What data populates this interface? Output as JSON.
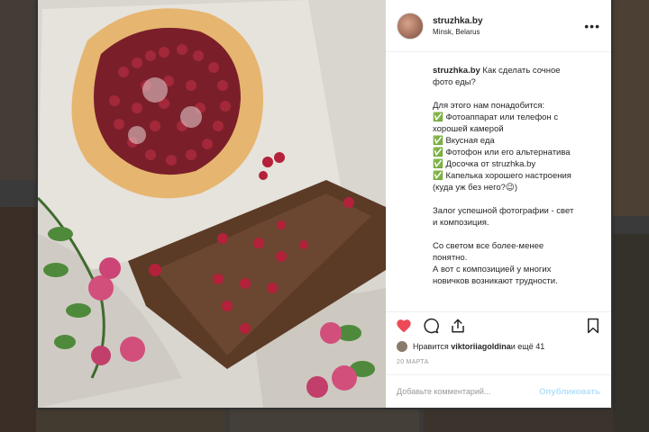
{
  "post": {
    "username": "struzhka.by",
    "location": "Minsk, Belarus",
    "caption_user": "struzhka.by",
    "caption_first": " Как сделать сочное",
    "caption_lines": [
      "фото еды?",
      "",
      "Для этого нам понадобится:",
      "✅ Фотоаппарат или телефон с",
      "хорошей камерой",
      "✅ Вкусная еда",
      "✅ Фотофон или его альтернатива",
      "✅ Досочка от struzhka.by",
      "✅ Капелька хорошего настроения",
      "(куда уж без него?😉)",
      "",
      "Залог успешной фотографии - свет",
      "и композиция.",
      "",
      "Со светом все более-менее",
      "понятно.",
      "А вот с композицией у многих",
      "новичков возникают трудности."
    ],
    "likes_prefix": "Нравится ",
    "likes_user": "viktoriiagoldina",
    "likes_suffix": " и ещё 41",
    "date": "20 МАРТА",
    "comment_placeholder": "Добавьте комментарий...",
    "post_label": "Опубликовать"
  },
  "colors": {
    "heart": "#ed4956",
    "post_disabled": "#b2dffc",
    "text": "#262626"
  },
  "icons": {
    "like": "heart-icon",
    "comment": "comment-icon",
    "share": "share-icon",
    "save": "bookmark-icon",
    "more": "more-dots-icon"
  }
}
